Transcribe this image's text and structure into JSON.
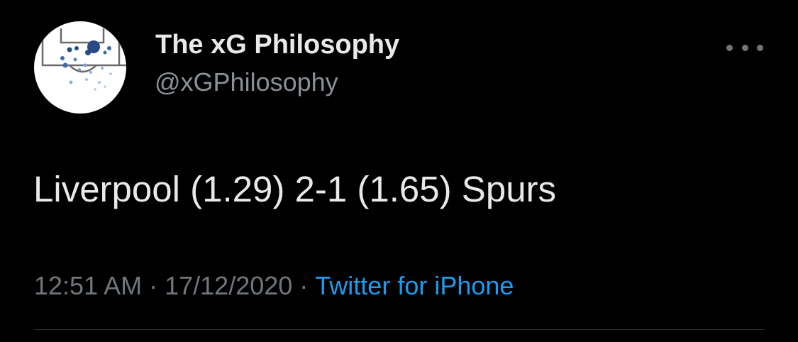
{
  "author": {
    "display_name": "The xG Philosophy",
    "handle": "@xGPhilosophy",
    "avatar_icon": "football-pitch-shot-map-logo"
  },
  "menu": {
    "icon": "more-horizontal-icon"
  },
  "tweet": {
    "text": "Liverpool (1.29) 2-1 (1.65) Spurs"
  },
  "meta": {
    "time": "12:51 AM",
    "separator": "·",
    "date": "17/12/2020",
    "source": "Twitter for iPhone"
  },
  "colors": {
    "background": "#000000",
    "primary_text": "#e7e9ea",
    "secondary_text": "#71767b",
    "link": "#1d9bf0",
    "divider": "#2f3336"
  }
}
